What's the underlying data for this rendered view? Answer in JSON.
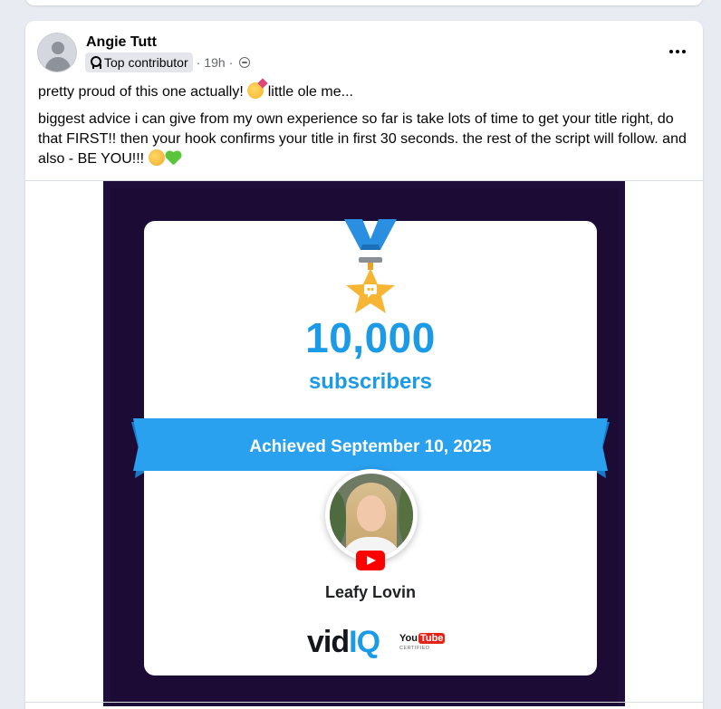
{
  "post": {
    "author": "Angie Tutt",
    "badge": "Top contributor",
    "time": "19h",
    "separator": "·",
    "audience_icon": "globe-icon",
    "more_icon": "more-horizontal-icon",
    "paragraph1": "pretty proud of this one actually!",
    "paragraph1_tail": "little ole me...",
    "paragraph2": "biggest advice i can give from my own experience so far is take lots of time to get your title right, do that FIRST!! then your hook confirms your title in first 30 seconds. the rest of the script will follow. and also - BE YOU!!!"
  },
  "certificate": {
    "number": "10,000",
    "label": "subscribers",
    "achieved": "Achieved September 10, 2025",
    "channel": "Leafy Lovin",
    "brand_vid": "vid",
    "brand_iq": "IQ",
    "yt_you": "You",
    "yt_tube": "Tube",
    "yt_certified": "CERTIFIED"
  },
  "colors": {
    "accent_blue": "#1b9ae6",
    "background": "#e9ebf3",
    "card": "#ffffff",
    "media_bg": "#1f0e3a",
    "medal_gold": "#f6b533"
  }
}
